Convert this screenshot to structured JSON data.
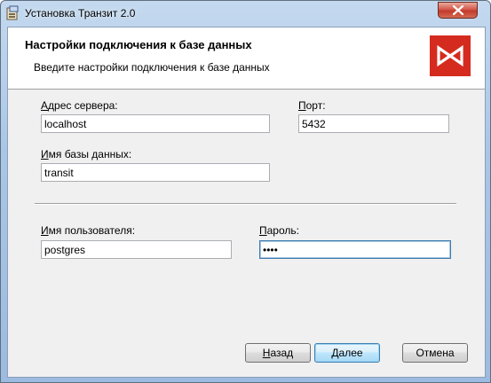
{
  "window": {
    "title": "Установка Транзит 2.0",
    "close_glyph": "✕"
  },
  "header": {
    "title": "Настройки подключения к базе данных",
    "subtitle": "Введите настройки подключения к базе данных",
    "logo_icon": "moex-logo-icon",
    "logo_color": "#d52b1e"
  },
  "form": {
    "server": {
      "label_hotkey": "А",
      "label_rest": "дрес сервера:",
      "value": "localhost"
    },
    "port": {
      "label_hotkey": "П",
      "label_rest": "орт:",
      "value": "5432"
    },
    "database": {
      "label_hotkey": "И",
      "label_rest": "мя базы данных:",
      "value": "transit"
    },
    "user": {
      "label_hotkey": "И",
      "label_rest": "мя пользователя:",
      "value": "postgres"
    },
    "password": {
      "label_hotkey": "П",
      "label_rest": "ароль:",
      "value": "••••"
    }
  },
  "buttons": {
    "back": {
      "hotkey": "Н",
      "rest": "азад"
    },
    "next": {
      "hotkey": "Д",
      "rest": "алее"
    },
    "cancel": {
      "label": "Отмена"
    }
  }
}
